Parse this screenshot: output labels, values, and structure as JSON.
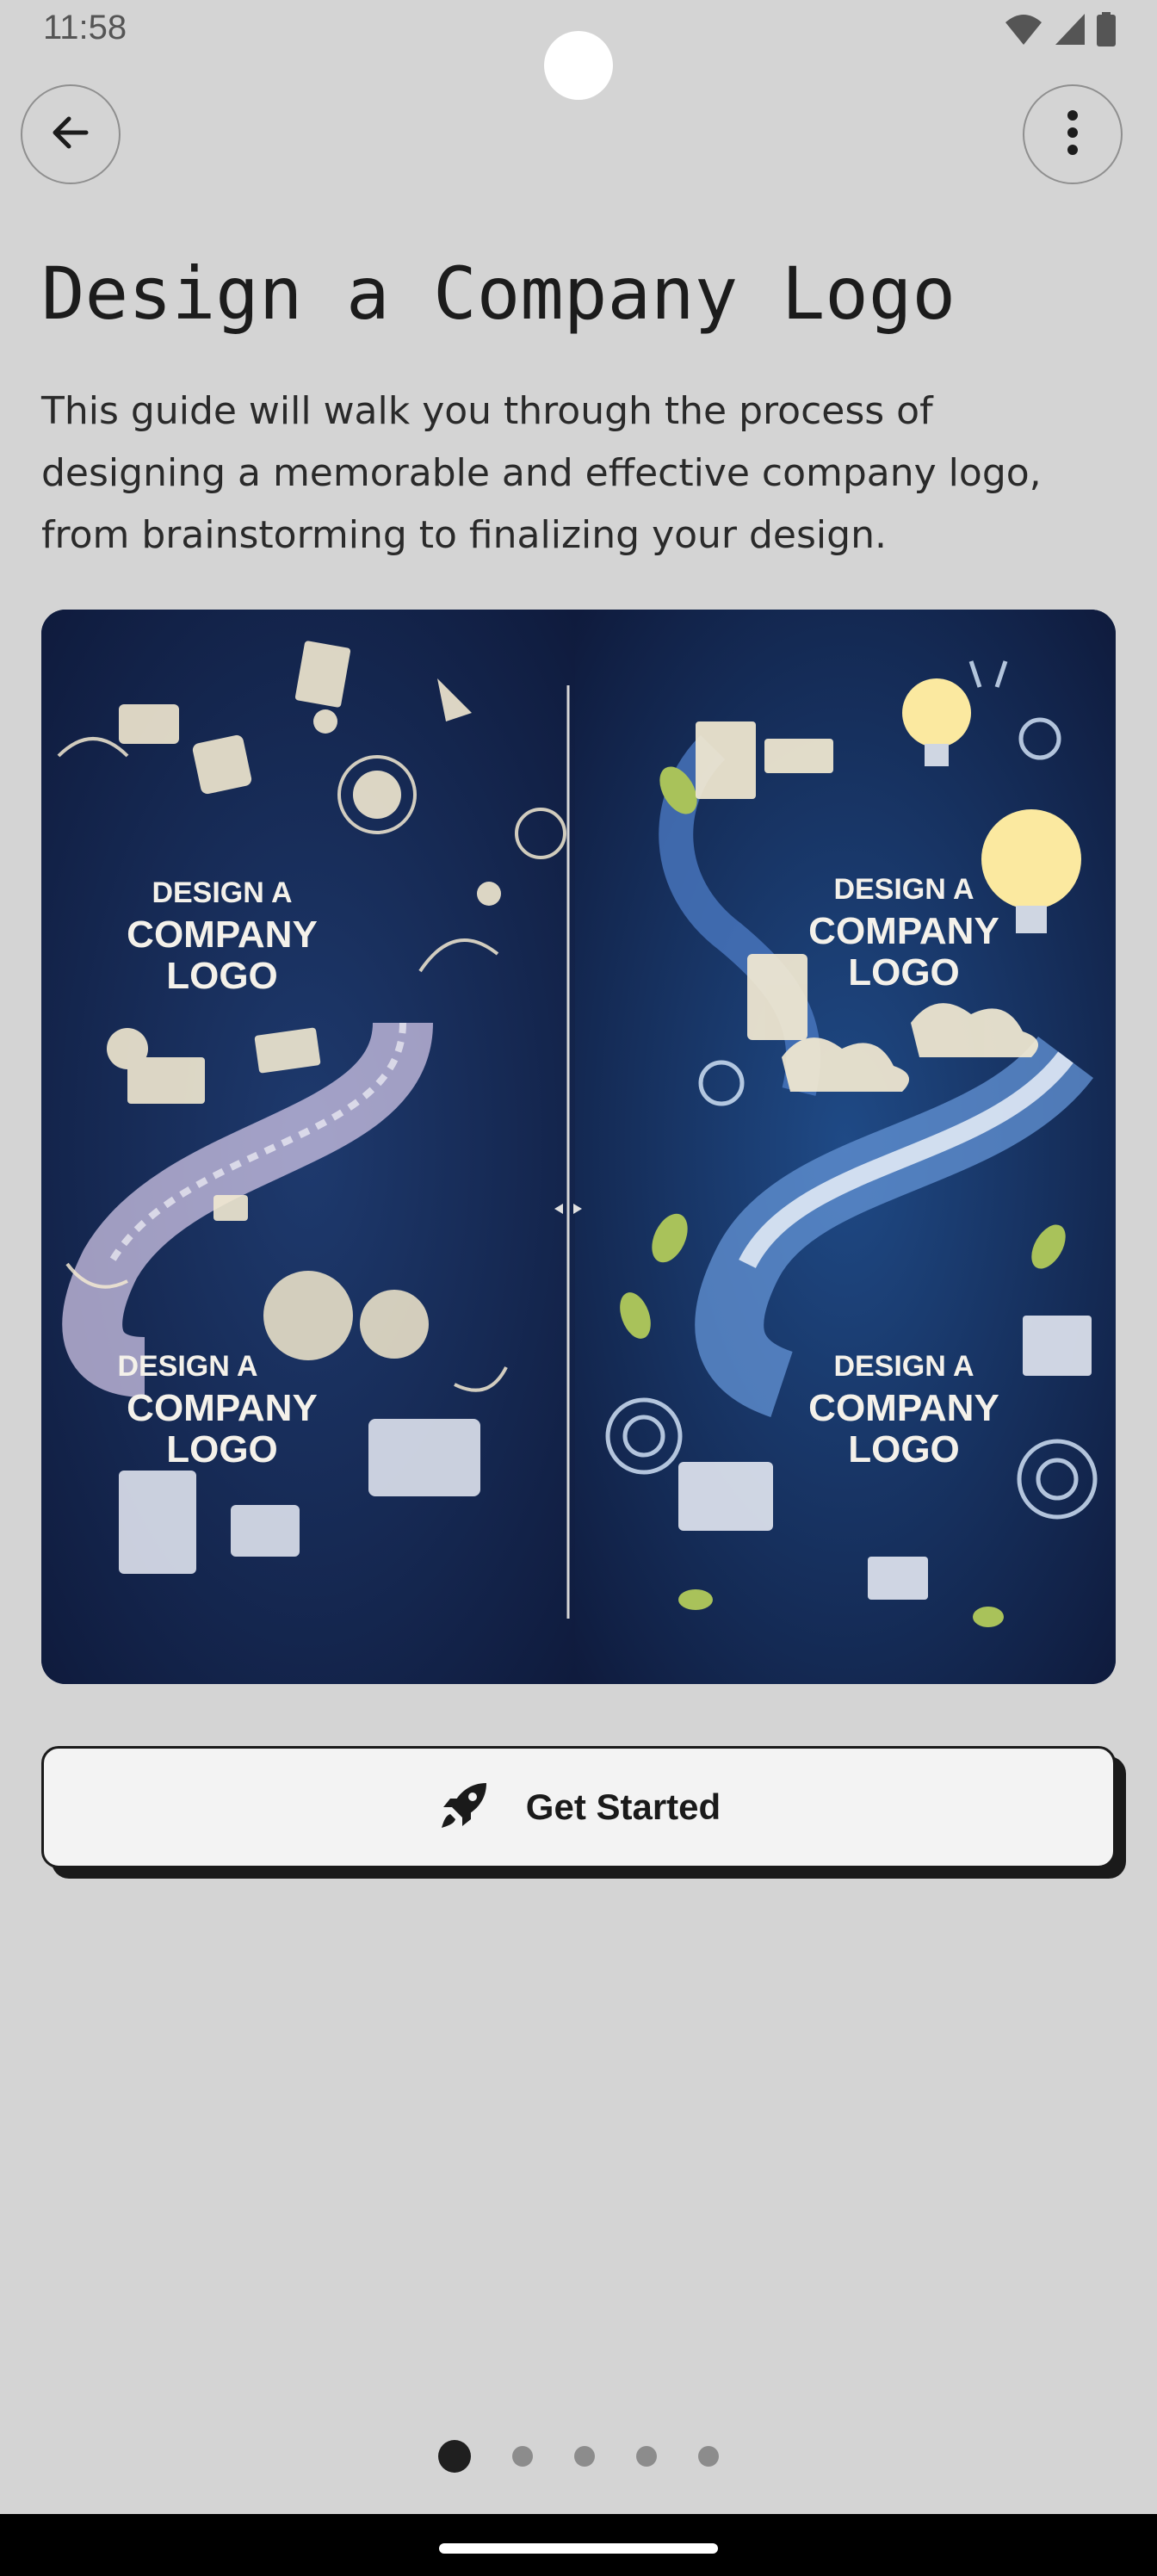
{
  "status_bar": {
    "time": "11:58",
    "icons": [
      "wifi-icon",
      "signal-icon",
      "battery-icon"
    ]
  },
  "toolbar": {
    "back_icon": "arrow-left-icon",
    "more_icon": "more-vertical-icon"
  },
  "page": {
    "title": "Design a Company Logo",
    "description": "This guide will walk you through the process of designing a memorable and effective company logo, from brainstorming to finalizing your design."
  },
  "hero_image": {
    "panels": [
      {
        "text_top": {
          "line1": "DESIGN A",
          "line2": "COMPANY",
          "line3": "LOGO"
        },
        "text_bottom": {
          "line1": "DESIGN A",
          "line2": "COMPANY",
          "line3": "LOGO"
        }
      },
      {
        "text_top": {
          "line1": "DESIGN A",
          "line2": "COMPANY",
          "line3": "LOGO"
        },
        "text_bottom": {
          "line1": "DESIGN A",
          "line2": "COMPANY",
          "line3": "LOGO"
        }
      }
    ],
    "colors": {
      "background": "#15254d",
      "ink": "#f3ead2",
      "accent": "#5f8fd0",
      "leaf": "#a9c25a",
      "bulb": "#fbe9a0"
    }
  },
  "cta": {
    "label": "Get Started",
    "icon": "rocket-icon"
  },
  "pager": {
    "count": 5,
    "active_index": 0
  },
  "colors": {
    "background": "#d4d4d4",
    "text": "#1c1c1c",
    "button_surface": "#f3f3f3",
    "button_border": "#1a1a1a"
  }
}
